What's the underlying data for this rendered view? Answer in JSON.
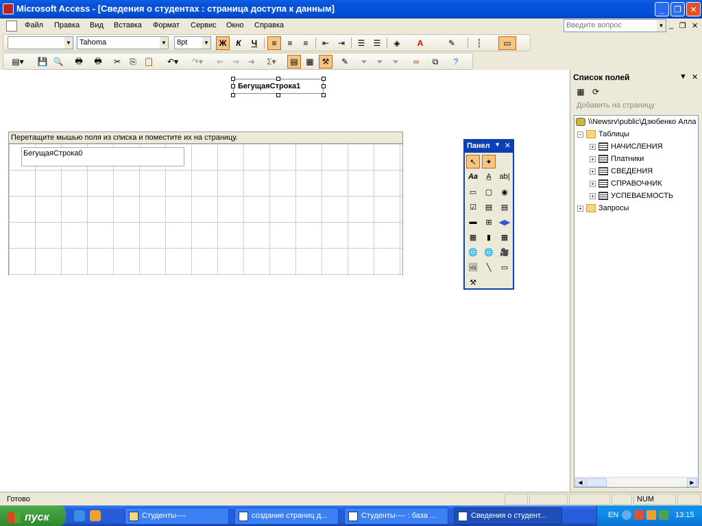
{
  "window": {
    "title": "Microsoft Access - [Сведения о студентах : страница доступа к данным]",
    "controls": {
      "minimize": "_",
      "restore": "❐",
      "close": "✕"
    }
  },
  "menu": {
    "items": [
      "Файл",
      "Правка",
      "Вид",
      "Вставка",
      "Формат",
      "Сервис",
      "Окно",
      "Справка"
    ],
    "help_placeholder": "Введите вопрос",
    "mdi_min": "_",
    "mdi_restore": "❐",
    "mdi_close": "✕"
  },
  "format_toolbar": {
    "style_value": "",
    "font_value": "Tahoma",
    "size_value": "8pt",
    "bold_label": "Ж",
    "italic_label": "К",
    "underline_label": "Ч"
  },
  "page": {
    "marquee_label": "БегущаяСтрока1",
    "section_hint": "Перетащите мышью поля из списка и поместите их на страницу.",
    "bound_field_label": "БегущаяСтрока0"
  },
  "toolbox": {
    "title": "Панел",
    "close": "✕",
    "menu": "▼"
  },
  "field_list": {
    "title": "Список полей",
    "add_to_page": "Добавить на страницу",
    "root": "\\\\Newsrv\\public\\Дзюбенко Алла",
    "tables_folder": "Таблицы",
    "tables": [
      "НАЧИСЛЕНИЯ",
      "Платники",
      "СВЕДЕНИЯ",
      "СПРАВОЧНИК",
      "УСПЕВАЕМОСТЬ"
    ],
    "queries_folder": "Запросы",
    "menu": "▼",
    "close": "✕"
  },
  "status": {
    "text": "Готово",
    "num": "NUM"
  },
  "taskbar": {
    "start": "пуск",
    "tasks": [
      "Студенты----",
      "создание страниц д...",
      "Студенты---- : база ...",
      "Сведения о студент..."
    ],
    "lang": "EN",
    "clock": "13:15"
  },
  "colors": {
    "titlebar": "#0054e3",
    "start": "#3c9a3c",
    "active_button": "#f5c585",
    "font_color": "#e00000"
  }
}
